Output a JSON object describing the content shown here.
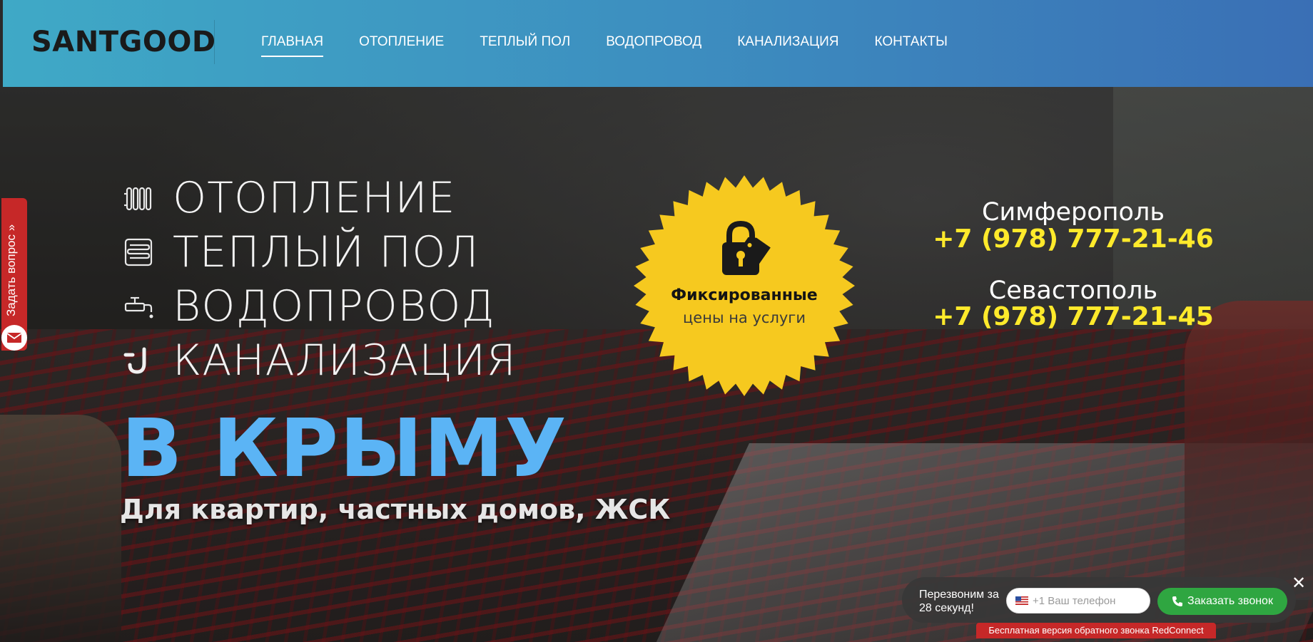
{
  "header": {
    "logo": "SANTGOOD",
    "nav": [
      {
        "label": "ГЛАВНАЯ",
        "active": true
      },
      {
        "label": "ОТОПЛЕНИЕ",
        "active": false
      },
      {
        "label": "ТЕПЛЫЙ ПОЛ",
        "active": false
      },
      {
        "label": "ВОДОПРОВОД",
        "active": false
      },
      {
        "label": "КАНАЛИЗАЦИЯ",
        "active": false
      },
      {
        "label": "КОНТАКТЫ",
        "active": false
      }
    ]
  },
  "hero": {
    "services": [
      {
        "label": "ОТОПЛЕНИЕ",
        "icon": "radiator-icon"
      },
      {
        "label": "ТЕПЛЫЙ ПОЛ",
        "icon": "floor-heating-icon"
      },
      {
        "label": "ВОДОПРОВОД",
        "icon": "faucet-icon"
      },
      {
        "label": "КАНАЛИЗАЦИЯ",
        "icon": "drain-pipe-icon"
      }
    ],
    "headline": "В КРЫМУ",
    "subtitle": "Для квартир, частных домов, ЖСК",
    "badge": {
      "line1": "Фиксированные",
      "line2": "цены на услуги",
      "icon": "lock-tag-icon",
      "color": "#f6c91f"
    },
    "contacts": [
      {
        "city": "Симферополь",
        "phone": "+7 (978) 777-21-46"
      },
      {
        "city": "Севастополь",
        "phone": "+7 (978) 777-21-45"
      }
    ],
    "colors": {
      "headline": "#5bb4f5",
      "phone": "#ffea2b"
    }
  },
  "side_tab": {
    "label": "Задать вопрос »",
    "icon": "mail-icon",
    "color": "#c62828"
  },
  "callback": {
    "text": "Перезвоним за 28 секунд!",
    "placeholder": "+1 Ваш телефон",
    "button": "Заказать звонок",
    "flag_icon": "us-flag-icon",
    "phone_icon": "phone-icon",
    "close": "✕",
    "credit": "Бесплатная версия обратного звонка RedConnect"
  }
}
